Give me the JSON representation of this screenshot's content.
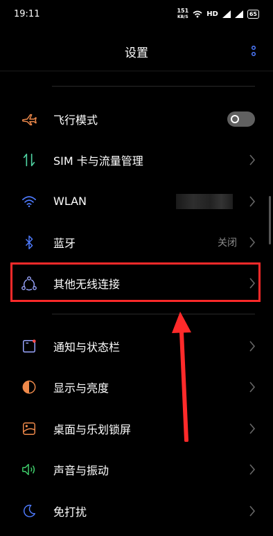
{
  "status": {
    "time": "19:11",
    "speed_value": "151",
    "speed_unit": "KB/S",
    "network": "HD",
    "battery": "65"
  },
  "header": {
    "title": "设置"
  },
  "items": [
    {
      "label": "飞行模式",
      "icon": "airplane-icon",
      "color": "#f08a4b"
    },
    {
      "label": "SIM 卡与流量管理",
      "icon": "sim-data-icon",
      "color": "#4fd3a2"
    },
    {
      "label": "WLAN",
      "icon": "wifi-icon",
      "color": "#4e7bff"
    },
    {
      "label": "蓝牙",
      "value": "关闭",
      "icon": "bluetooth-icon",
      "color": "#4e7bff"
    },
    {
      "label": "其他无线连接",
      "icon": "connection-icon",
      "color": "#9aa6ff"
    },
    {
      "label": "通知与状态栏",
      "icon": "notification-icon",
      "color": "#9aa6ff"
    },
    {
      "label": "显示与亮度",
      "icon": "display-icon",
      "color": "#f08a4b"
    },
    {
      "label": "桌面与乐划锁屏",
      "icon": "wallpaper-icon",
      "color": "#f08a4b"
    },
    {
      "label": "声音与振动",
      "icon": "sound-icon",
      "color": "#3fcf6b"
    },
    {
      "label": "免打扰",
      "icon": "moon-icon",
      "color": "#4e7bff"
    }
  ],
  "annotation_color": "#ff2a2a"
}
